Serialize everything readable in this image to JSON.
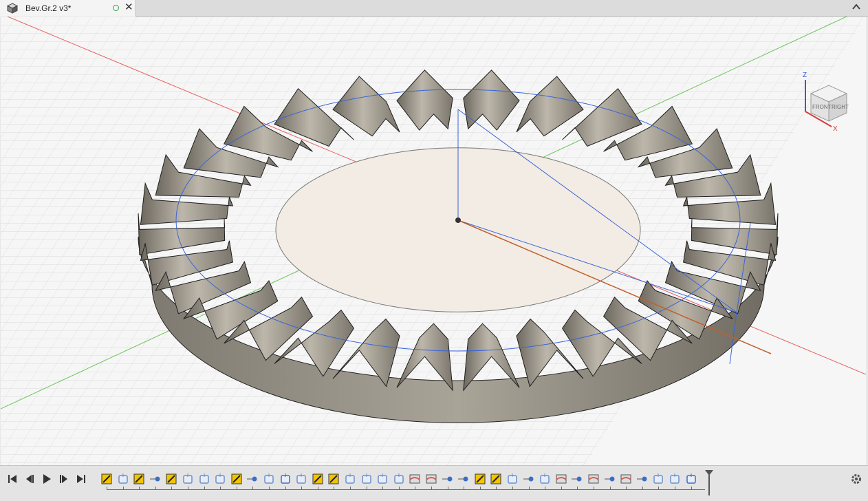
{
  "document_tab": {
    "title": "Bev.Gr.2 v3*",
    "doc_icon": "box-icon",
    "status_icon": "saved-status-circle-icon",
    "close_label": "✕"
  },
  "window": {
    "maximize_icon": "chevron-up-icon"
  },
  "viewcube": {
    "face_front": "FRONT",
    "face_right": "RIGHT",
    "axis_z": "Z",
    "axis_x": "X"
  },
  "timeline": {
    "playback": [
      "skip-to-start-icon",
      "step-back-icon",
      "play-icon",
      "step-forward-icon",
      "skip-to-end-icon"
    ],
    "features": [
      "sketch",
      "extrude",
      "sketch",
      "point",
      "sketch",
      "revolve",
      "revolve",
      "extrude",
      "sketch",
      "point",
      "shell",
      "move",
      "combine",
      "sketch",
      "sketch",
      "shell",
      "sweep",
      "extrude",
      "extrude",
      "loft",
      "loft",
      "point",
      "point",
      "sketch",
      "sketch",
      "shell",
      "point",
      "extrude",
      "loft",
      "point",
      "loft",
      "point",
      "loft",
      "point",
      "combine",
      "sweep",
      "move"
    ],
    "settings_icon": "gear-icon"
  },
  "colors": {
    "gear_fill": "#8a857c",
    "grid": "#d9d9d9",
    "x_axis": "#e04848",
    "y_axis": "#55b84a",
    "sketch": "#3a64d8"
  }
}
